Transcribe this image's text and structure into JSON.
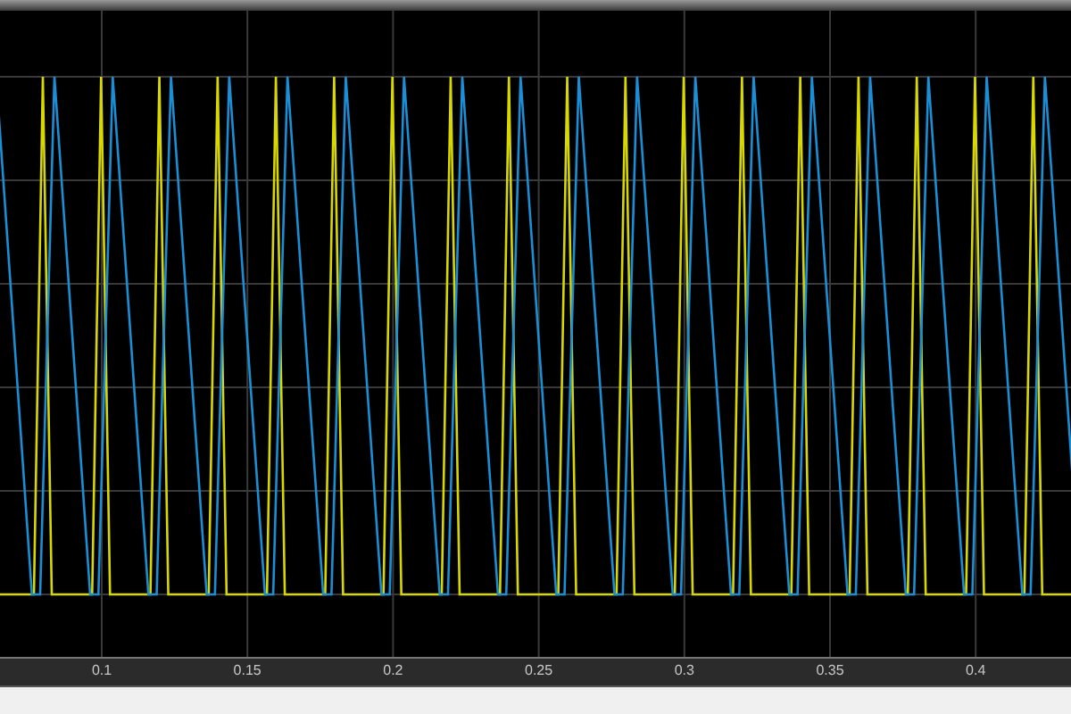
{
  "scope": {
    "x_ticks": [
      "0.1",
      "0.15",
      "0.2",
      "0.25",
      "0.3",
      "0.35",
      "0.4"
    ],
    "signals": [
      {
        "kind": "triangle",
        "color": "#d8d800"
      },
      {
        "kind": "sawtooth",
        "color": "#1a8fd6"
      }
    ]
  }
}
